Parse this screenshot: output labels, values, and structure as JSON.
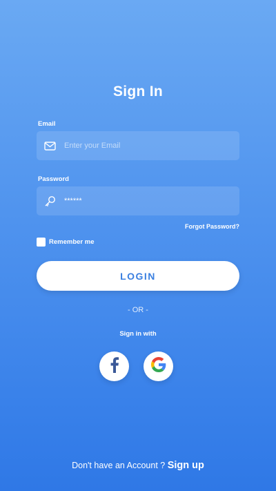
{
  "header": {
    "title": "Sign In"
  },
  "form": {
    "email": {
      "label": "Email",
      "placeholder": "Enter your Email",
      "value": "",
      "icon": "mail-icon"
    },
    "password": {
      "label": "Password",
      "value": "******",
      "icon": "key-icon"
    },
    "forgot_label": "Forgot Password?",
    "remember_label": "Remember me",
    "remember_checked": false,
    "login_label": "LOGIN"
  },
  "social": {
    "divider": "- OR -",
    "heading": "Sign in with",
    "providers": [
      {
        "name": "facebook",
        "icon": "facebook-icon",
        "color": "#3b5998"
      },
      {
        "name": "google",
        "icon": "google-icon",
        "colors": [
          "#4285F4",
          "#EA4335",
          "#FBBC05",
          "#34A853"
        ]
      }
    ]
  },
  "footer": {
    "prompt": "Don't have an Account ?",
    "signup_label": "Sign up"
  },
  "colors": {
    "gradient_top": "#6aa9f3",
    "gradient_bottom": "#2f78e6",
    "login_text": "#3a7fe0"
  }
}
